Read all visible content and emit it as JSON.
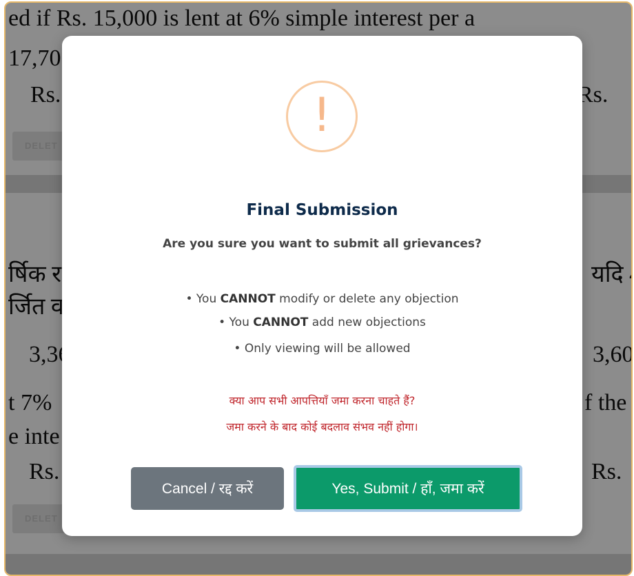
{
  "background": {
    "line1": "ed if Rs. 15,000 is lent at 6% simple interest per a",
    "line2": "17,70",
    "rs_left_1": "Rs.",
    "rs_right_1": "Rs.",
    "delete_1": "DELET",
    "hindi_left_1": "र्षिक र",
    "hindi_right_1": "यदि 4",
    "hindi_left_2": "र्जित व",
    "num_left": "3,36",
    "num_right": "3,60",
    "line_7pct": "t 7%",
    "line_the": "f the",
    "line_inte": "e inte",
    "rs_left_2": "Rs.",
    "rs_right_2": "Rs.",
    "delete_2": "DELET"
  },
  "modal": {
    "title": "Final Submission",
    "subtitle": "Are you sure you want to submit all grievances?",
    "bullets": [
      {
        "prefix": "• You ",
        "strong": "CANNOT",
        "suffix": " modify or delete any objection"
      },
      {
        "prefix": "• You ",
        "strong": "CANNOT",
        "suffix": " add new objections"
      },
      {
        "prefix": "• Only viewing will be allowed",
        "strong": "",
        "suffix": ""
      }
    ],
    "hindi_line1": "क्या आप सभी आपत्तियाँ जमा करना चाहते हैं?",
    "hindi_line2": "जमा करने के बाद कोई बदलाव संभव नहीं होगा।",
    "cancel_label": "Cancel / रद्द करें",
    "submit_label": "Yes, Submit / हाँ, जमा करें",
    "icon": "warning-exclamation-icon",
    "colors": {
      "icon": "#f6b88b",
      "submit": "#0c9a6a",
      "cancel": "#6c757d",
      "hindi": "#c0262c",
      "title": "#0d2a4a"
    }
  }
}
